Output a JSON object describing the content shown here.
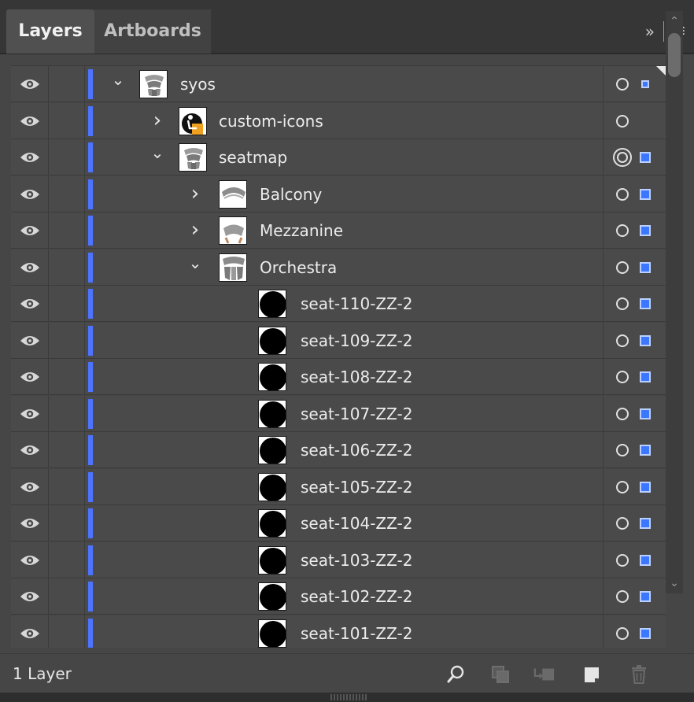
{
  "tabs": [
    {
      "label": "Layers",
      "active": true
    },
    {
      "label": "Artboards",
      "active": false
    }
  ],
  "panel_menu": {
    "collapse_glyph": "»",
    "menu_glyph": "≡"
  },
  "accent_color": "#4d73ff",
  "layers": [
    {
      "name": "syos",
      "depth": 0,
      "expanded": true,
      "thumb": "seatmap",
      "target": "single",
      "selected": "small"
    },
    {
      "name": "custom-icons",
      "depth": 1,
      "expanded": false,
      "thumb": "icons",
      "target": "single",
      "selected": "none"
    },
    {
      "name": "seatmap",
      "depth": 1,
      "expanded": true,
      "thumb": "seatmap",
      "target": "double",
      "selected": "full"
    },
    {
      "name": "Balcony",
      "depth": 2,
      "expanded": false,
      "thumb": "balcony",
      "target": "single",
      "selected": "full"
    },
    {
      "name": "Mezzanine",
      "depth": 2,
      "expanded": false,
      "thumb": "mezzanine",
      "target": "single",
      "selected": "full"
    },
    {
      "name": "Orchestra",
      "depth": 2,
      "expanded": true,
      "thumb": "orchestra",
      "target": "single",
      "selected": "full"
    },
    {
      "name": "seat-110-ZZ-2",
      "depth": 3,
      "expanded": null,
      "thumb": "seat",
      "target": "single",
      "selected": "full"
    },
    {
      "name": "seat-109-ZZ-2",
      "depth": 3,
      "expanded": null,
      "thumb": "seat",
      "target": "single",
      "selected": "full"
    },
    {
      "name": "seat-108-ZZ-2",
      "depth": 3,
      "expanded": null,
      "thumb": "seat",
      "target": "single",
      "selected": "full"
    },
    {
      "name": "seat-107-ZZ-2",
      "depth": 3,
      "expanded": null,
      "thumb": "seat",
      "target": "single",
      "selected": "full"
    },
    {
      "name": "seat-106-ZZ-2",
      "depth": 3,
      "expanded": null,
      "thumb": "seat",
      "target": "single",
      "selected": "full"
    },
    {
      "name": "seat-105-ZZ-2",
      "depth": 3,
      "expanded": null,
      "thumb": "seat",
      "target": "single",
      "selected": "full"
    },
    {
      "name": "seat-104-ZZ-2",
      "depth": 3,
      "expanded": null,
      "thumb": "seat",
      "target": "single",
      "selected": "full"
    },
    {
      "name": "seat-103-ZZ-2",
      "depth": 3,
      "expanded": null,
      "thumb": "seat",
      "target": "single",
      "selected": "full"
    },
    {
      "name": "seat-102-ZZ-2",
      "depth": 3,
      "expanded": null,
      "thumb": "seat",
      "target": "single",
      "selected": "full"
    },
    {
      "name": "seat-101-ZZ-2",
      "depth": 3,
      "expanded": null,
      "thumb": "seat",
      "target": "single",
      "selected": "full"
    }
  ],
  "footer": {
    "layer_count": "1 Layer",
    "buttons": [
      "locate-object-icon",
      "make-clipping-mask-icon",
      "new-sublayer-icon",
      "new-layer-icon",
      "delete-icon"
    ]
  }
}
